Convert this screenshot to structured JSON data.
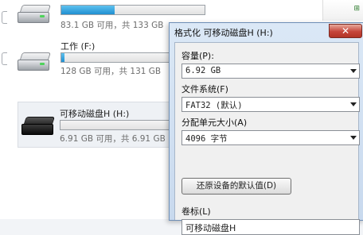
{
  "explorer": {
    "drives": [
      {
        "name": "",
        "usage_fraction": 0.37,
        "info": "83.1 GB 可用，共 133 GB"
      },
      {
        "name": "工作 (F:)",
        "usage_fraction": 0.02,
        "info": "128 GB 可用，共 131 GB"
      },
      {
        "name": "可移动磁盘H (H:)",
        "usage_fraction": 0.0,
        "info": "6.91 GB 可用，共 6.91 GB"
      }
    ]
  },
  "dialog": {
    "title": "格式化 可移动磁盘H (H:)",
    "close_symbol": "✕",
    "capacity": {
      "label": "容量(P):",
      "value": "6.92 GB"
    },
    "filesystem": {
      "label": "文件系统(F)",
      "value": "FAT32 (默认)"
    },
    "allocation": {
      "label": "分配单元大小(A)",
      "value": "4096 字节"
    },
    "restore_button": "还原设备的默认值(D)",
    "volume_label": {
      "label": "卷标(L)",
      "value": "可移动磁盘H"
    }
  }
}
